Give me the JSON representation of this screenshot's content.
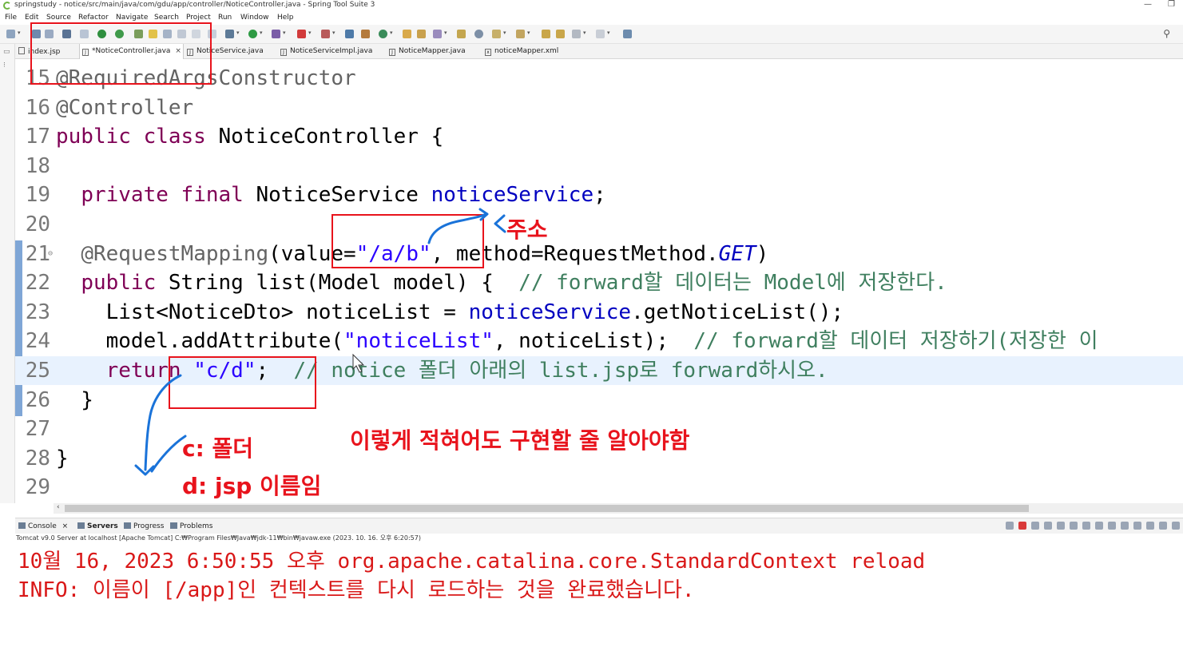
{
  "window": {
    "title": "springstudy - notice/src/main/java/com/gdu/app/controller/NoticeController.java - Spring Tool Suite 3",
    "minimize": "—",
    "restore": "❐"
  },
  "menu": [
    "File",
    "Edit",
    "Source",
    "Refactor",
    "Navigate",
    "Search",
    "Project",
    "Run",
    "Window",
    "Help"
  ],
  "tabs": [
    {
      "label": "index.jsp",
      "active": false
    },
    {
      "label": "*NoticeController.java",
      "active": true,
      "close": "×"
    },
    {
      "label": "NoticeService.java",
      "active": false
    },
    {
      "label": "NoticeServiceImpl.java",
      "active": false
    },
    {
      "label": "NoticeMapper.java",
      "active": false
    },
    {
      "label": "noticeMapper.xml",
      "active": false
    }
  ],
  "editor": {
    "lines": [
      {
        "n": "15",
        "tokens": [
          {
            "t": "@RequiredArgsConstructor",
            "c": "ann"
          }
        ]
      },
      {
        "n": "16",
        "tokens": [
          {
            "t": "@Controller",
            "c": "ann"
          }
        ]
      },
      {
        "n": "17",
        "tokens": [
          {
            "t": "public class",
            "c": "kw"
          },
          {
            "t": " NoticeController {",
            "c": ""
          }
        ]
      },
      {
        "n": "18",
        "tokens": []
      },
      {
        "n": "19",
        "tokens": [
          {
            "t": "  ",
            "c": ""
          },
          {
            "t": "private final",
            "c": "kw"
          },
          {
            "t": " NoticeService ",
            "c": ""
          },
          {
            "t": "noticeService",
            "c": "fld"
          },
          {
            "t": ";",
            "c": ""
          }
        ]
      },
      {
        "n": "20",
        "tokens": []
      },
      {
        "n": "21",
        "fold": "⊖",
        "tokens": [
          {
            "t": "  ",
            "c": ""
          },
          {
            "t": "@RequestMapping",
            "c": "ann"
          },
          {
            "t": "(value=",
            "c": ""
          },
          {
            "t": "\"/a/b\"",
            "c": "str"
          },
          {
            "t": ", method=RequestMethod.",
            "c": ""
          },
          {
            "t": "GET",
            "c": "fld it"
          },
          {
            "t": ")",
            "c": ""
          }
        ]
      },
      {
        "n": "22",
        "tokens": [
          {
            "t": "  ",
            "c": ""
          },
          {
            "t": "public",
            "c": "kw"
          },
          {
            "t": " String list(Model model) {  ",
            "c": ""
          },
          {
            "t": "// forward할 데이터는 Model에 저장한다.",
            "c": "cmt"
          }
        ]
      },
      {
        "n": "23",
        "tokens": [
          {
            "t": "    List<NoticeDto> noticeList = ",
            "c": ""
          },
          {
            "t": "noticeService",
            "c": "fld"
          },
          {
            "t": ".getNoticeList();",
            "c": ""
          }
        ]
      },
      {
        "n": "24",
        "tokens": [
          {
            "t": "    model.addAttribute(",
            "c": ""
          },
          {
            "t": "\"noticeList\"",
            "c": "str"
          },
          {
            "t": ", noticeList);  ",
            "c": ""
          },
          {
            "t": "// forward할 데이터 저장하기(저장한 이",
            "c": "cmt"
          }
        ]
      },
      {
        "n": "25",
        "current": true,
        "tokens": [
          {
            "t": "    ",
            "c": ""
          },
          {
            "t": "return",
            "c": "kw"
          },
          {
            "t": " ",
            "c": ""
          },
          {
            "t": "\"c/d\"",
            "c": "str"
          },
          {
            "t": ";  ",
            "c": ""
          },
          {
            "t": "// notice 폴더 아래의 list.jsp로 forward하시오.",
            "c": "cmt"
          }
        ]
      },
      {
        "n": "26",
        "tokens": [
          {
            "t": "  }",
            "c": ""
          }
        ]
      },
      {
        "n": "27",
        "tokens": []
      },
      {
        "n": "28",
        "tokens": [
          {
            "t": "}",
            "c": ""
          }
        ]
      },
      {
        "n": "29",
        "tokens": []
      }
    ]
  },
  "notes": {
    "address": "주소",
    "folder": "c: 폴더",
    "jsp_name": "d: jsp 이름임",
    "implement": "이렇게 적혀어도 구현할 줄 알아야함"
  },
  "console": {
    "tabs": [
      {
        "label": "Console",
        "close": "×"
      },
      {
        "label": "Servers"
      },
      {
        "label": "Progress"
      },
      {
        "label": "Problems"
      }
    ],
    "status": "Tomcat v9.0 Server at localhost [Apache Tomcat] C:₩Program Files₩Java₩jdk-11₩bin₩javaw.exe  (2023. 10. 16. 오후 6:20:57)",
    "output": [
      "10월 16, 2023 6:50:55 오후 org.apache.catalina.core.StandardContext reload",
      "INFO: 이름이 [/app]인 컨텍스트를 다시 로드하는 것을 완료했습니다."
    ]
  },
  "colors": {
    "annotation_red": "#e8131c",
    "annotation_blue": "#1a73d9",
    "keyword": "#7f0055",
    "string": "#2a00ff",
    "comment": "#3f7f5f",
    "console_text": "#d91818"
  }
}
